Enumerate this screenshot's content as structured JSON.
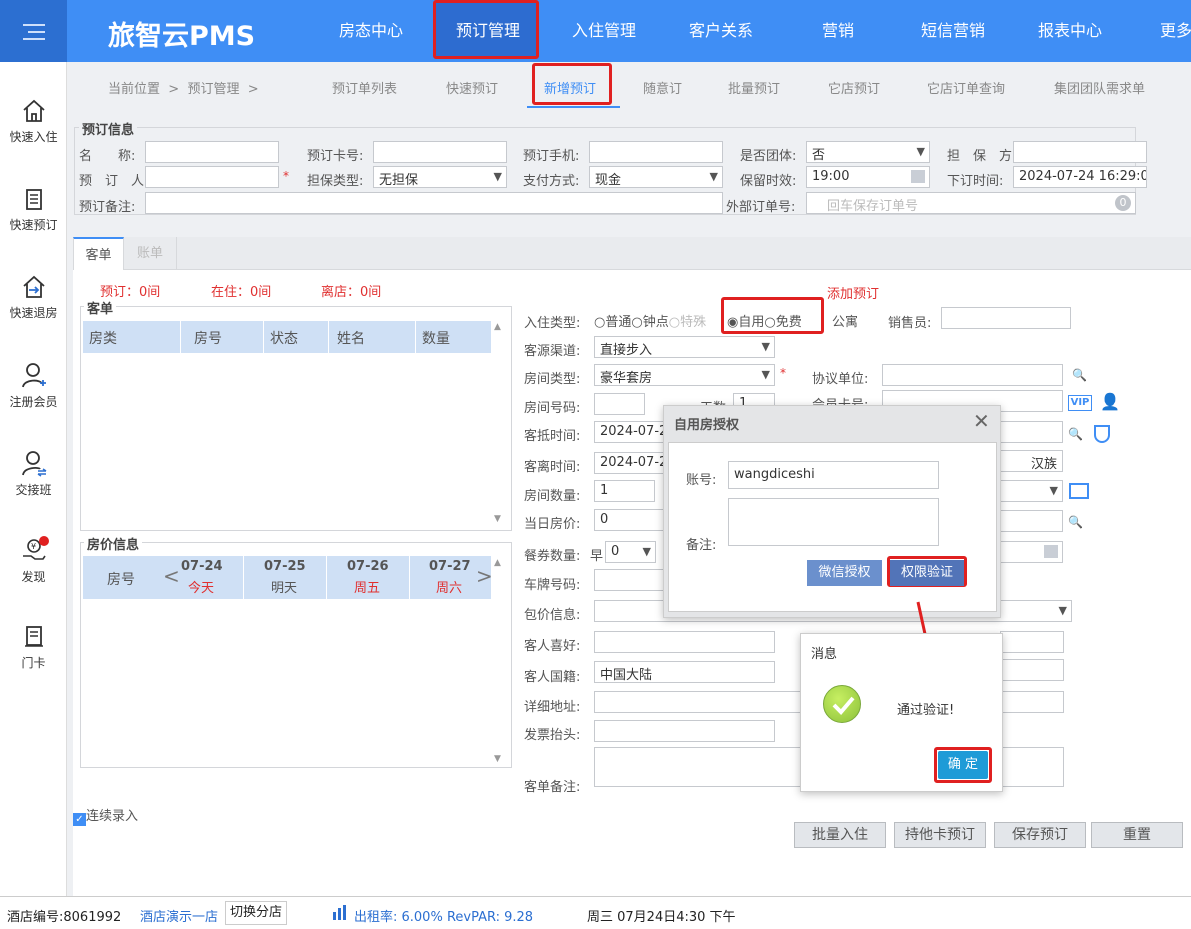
{
  "app": {
    "logo": "旅智云PMS"
  },
  "topnav": [
    "房态中心",
    "预订管理",
    "入住管理",
    "客户关系",
    "营销",
    "短信营销",
    "报表中心",
    "更多"
  ],
  "sidebar": [
    "快速入住",
    "快速预订",
    "快速退房",
    "注册会员",
    "交接班",
    "发现",
    "门卡"
  ],
  "breadcrumb": {
    "current": "当前位置",
    "sep": ">",
    "section": "预订管理",
    "sep2": ">"
  },
  "subtabs": [
    "预订单列表",
    "快速预订",
    "新增预订",
    "随意订",
    "批量预订",
    "它店预订",
    "它店订单查询",
    "集团团队需求单"
  ],
  "booking": {
    "legend": "预订信息",
    "name_label": "名　　称:",
    "card_label": "预订卡号:",
    "phone_label": "预订手机:",
    "group_label": "是否团体:",
    "group_value": "否",
    "guarantor_label": "担　保　方:",
    "booker_label": "预　订　人:",
    "guarantee_type_label": "担保类型:",
    "guarantee_type_value": "无担保",
    "pay_label": "支付方式:",
    "pay_value": "现金",
    "hold_label": "保留时效:",
    "hold_value": "19:00",
    "order_time_label": "下订时间:",
    "order_time_value": "2024-07-24 16:29:0",
    "remark_label": "预订备注:",
    "ext_label": "外部订单号:",
    "ext_placeholder": "回车保存订单号",
    "ext_count": "0"
  },
  "tabs": [
    "客单",
    "账单"
  ],
  "stats": {
    "reserved": "预订：0间",
    "staying": "在住：0间",
    "left": "离店：0间"
  },
  "add_booking": "添加预订",
  "guest": {
    "legend": "客单",
    "cols": [
      "房类",
      "房号",
      "状态",
      "姓名",
      "数量"
    ]
  },
  "price": {
    "legend": "房价信息",
    "room_label": "房号",
    "days": [
      {
        "date": "07-24",
        "day": "今天"
      },
      {
        "date": "07-25",
        "day": "明天"
      },
      {
        "date": "07-26",
        "day": "周五"
      },
      {
        "date": "07-27",
        "day": "周六"
      }
    ]
  },
  "form": {
    "checkin_type_label": "入住类型:",
    "types": [
      "普通",
      "钟点",
      "特殊",
      "自用",
      "免费",
      "公寓"
    ],
    "sales_label": "销售员:",
    "channel_label": "客源渠道:",
    "channel_value": "直接步入",
    "room_type_label": "房间类型:",
    "room_type_value": "豪华套房",
    "agreement_label": "协议单位:",
    "room_no_label": "房间号码:",
    "days_label": "天数:",
    "days_value": "1",
    "member_label": "会员卡号:",
    "arrive_label": "客抵时间:",
    "arrive_value": "2024-07-24",
    "leave_label": "客离时间:",
    "leave_value": "2024-07-25",
    "ethnic_value": "汉族",
    "count_label": "房间数量:",
    "count_value": "1",
    "price_label": "当日房价:",
    "price_value": "0",
    "meal_label": "餐券数量:",
    "meal_prefix": "早",
    "meal_value": "0",
    "plate_label": "车牌号码:",
    "package_label": "包价信息:",
    "pref_label": "客人喜好:",
    "nation_label": "客人国籍:",
    "nation_value": "中国大陆",
    "address_label": "详细地址:",
    "invoice_label": "发票抬头:",
    "note_label": "客单备注:"
  },
  "continuous": "连续录入",
  "buttons": {
    "batch": "批量入住",
    "other_card": "持他卡预订",
    "save": "保存预订",
    "reset": "重置"
  },
  "auth": {
    "title": "自用房授权",
    "account_label": "账号:",
    "account_value": "wangdiceshi",
    "remark_label": "备注:",
    "wechat": "微信授权",
    "verify": "权限验证"
  },
  "msg": {
    "title": "消息",
    "text": "通过验证!",
    "ok": "确 定"
  },
  "footer": {
    "hotel_no_label": "酒店编号:",
    "hotel_no": "8061992",
    "hotel_name": "酒店演示一店",
    "switch": "切换分店",
    "occupancy": "出租率: 6.00% RevPAR: 9.28",
    "datetime": "周三 07月24日4:30 下午"
  },
  "colors": {
    "primary": "#3f8ef5",
    "highlight": "#e02020",
    "ok_button": "#1e9bd7"
  }
}
